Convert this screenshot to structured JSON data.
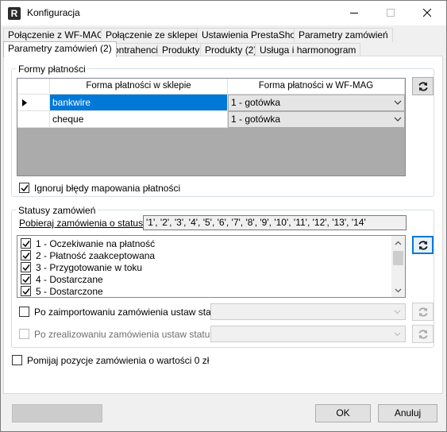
{
  "window": {
    "title": "Konfiguracja",
    "app_icon_letter": "R"
  },
  "tabs_row1": [
    {
      "label": "Połączenie z WF-MAG"
    },
    {
      "label": "Połączenie ze sklepem"
    },
    {
      "label": "Ustawienia PrestaShop"
    },
    {
      "label": "Parametry zamówień"
    }
  ],
  "tabs_row2": [
    {
      "label": "Parametry zamówień (2)",
      "active": true
    },
    {
      "label": "Kontrahenci"
    },
    {
      "label": "Produkty"
    },
    {
      "label": "Produkty (2)"
    },
    {
      "label": "Usługa i harmonogram"
    }
  ],
  "payment_forms": {
    "group_label": "Formy płatności",
    "columns": [
      "Forma płatności w sklepie",
      "Forma płatności w WF-MAG"
    ],
    "rows": [
      {
        "shop": "bankwire",
        "wfmag": "1 - gotówka",
        "current": true,
        "selected": true
      },
      {
        "shop": "cheque",
        "wfmag": "1 - gotówka"
      }
    ],
    "ignore_errors": {
      "label": "Ignoruj błędy mapowania płatności",
      "checked": true
    }
  },
  "order_statuses": {
    "group_label": "Statusy zamówień",
    "fetch_label": "Pobieraj zamówienia o statusie:",
    "fetch_value": "'1', '2', '3', '4', '5', '6', '7', '8', '9', '10', '11', '12', '13', '14'",
    "items": [
      {
        "label": "1 - Oczekiwanie na płatność",
        "checked": true
      },
      {
        "label": "2 - Płatność zaakceptowana",
        "checked": true
      },
      {
        "label": "3 - Przygotowanie w toku",
        "checked": true
      },
      {
        "label": "4 - Dostarczane",
        "checked": true
      },
      {
        "label": "5 - Dostarczone",
        "checked": true
      }
    ],
    "after_import": {
      "label": "Po zaimportowaniu zamówienia ustaw status:",
      "checked": false
    },
    "after_complete": {
      "label": "Po zrealizowaniu zamówienia ustaw status:",
      "checked": false,
      "disabled": true
    }
  },
  "skip_zero": {
    "label": "Pomijaj pozycje zamówienia o wartości 0 zł",
    "checked": false
  },
  "footer": {
    "ok_label": "OK",
    "cancel_label": "Anuluj",
    "left_button_label": ""
  },
  "colors": {
    "selection": "#0078d7",
    "grid_background": "#ababab",
    "window_background": "#f0f0f0"
  }
}
